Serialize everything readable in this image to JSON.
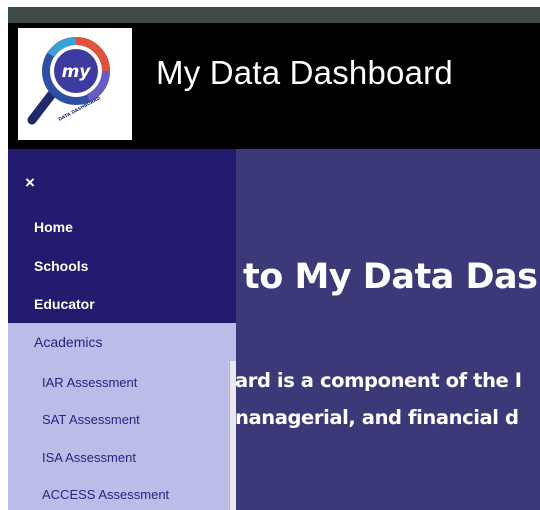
{
  "header": {
    "title": "My Data Dashboard",
    "logo": {
      "icon": "magnifier-logo-icon",
      "text_main": "my",
      "text_ring": "DATA DASHBOARD"
    }
  },
  "sidebar": {
    "close_label": "×",
    "items": [
      {
        "label": "Home"
      },
      {
        "label": "Schools"
      },
      {
        "label": "Educator"
      }
    ],
    "academics": {
      "label": "Academics",
      "subitems": [
        {
          "label": "IAR Assessment"
        },
        {
          "label": "SAT Assessment"
        },
        {
          "label": "ISA Assessment"
        },
        {
          "label": "ACCESS Assessment"
        }
      ]
    }
  },
  "main": {
    "welcome_visible": "to My Data Dash",
    "description_line1": "ard is a component of the I",
    "description_line2": "nanagerial, and financial d"
  },
  "colors": {
    "topbar": "#3d4a47",
    "header_bg": "#000000",
    "sidebar_bg": "#221b6e",
    "academics_bg": "#b9bde8",
    "main_bg": "#3c3979",
    "link_dark": "#2a2380"
  }
}
